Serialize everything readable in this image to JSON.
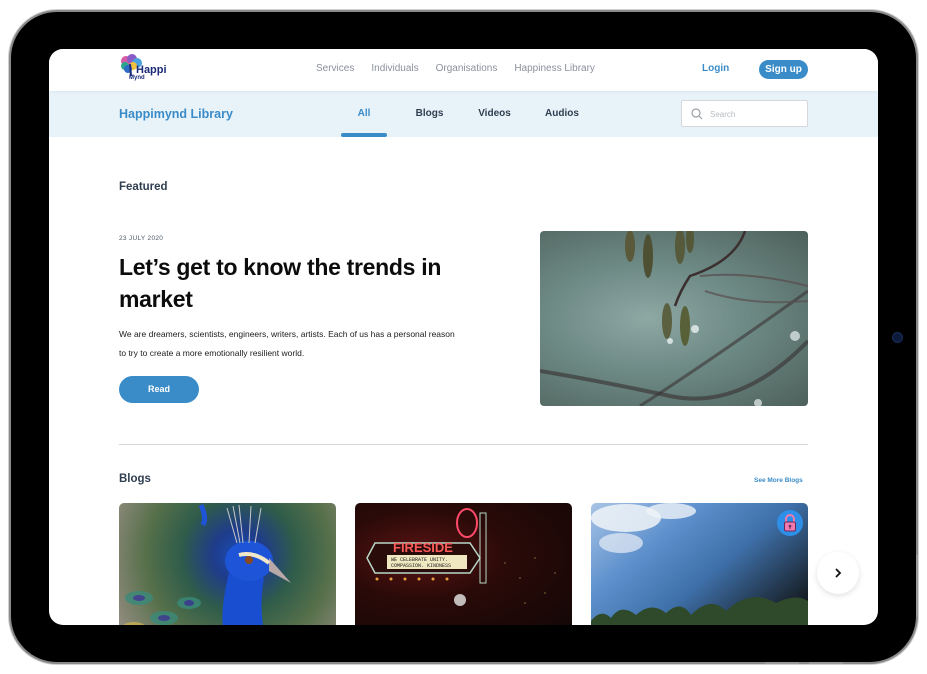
{
  "brand": {
    "logo_text": "Happi",
    "logo_subtext": "Mynd"
  },
  "topnav": {
    "links": [
      "Services",
      "Individuals",
      "Organisations",
      "Happiness Library"
    ],
    "login_label": "Login",
    "signup_label": "Sign up"
  },
  "library": {
    "title": "Happimynd Library",
    "tabs": [
      {
        "label": "All",
        "active": true
      },
      {
        "label": "Blogs",
        "active": false
      },
      {
        "label": "Videos",
        "active": false
      },
      {
        "label": "Audios",
        "active": false
      }
    ],
    "search": {
      "placeholder": "Search",
      "value": ""
    }
  },
  "featured": {
    "section_title": "Featured",
    "date": "23 JULY 2020",
    "headline": "Let’s get to know the trends in market",
    "description": "We are dreamers, scientists, engineers, writers, artists. Each of us has a personal reason to try to create a more emotionally resilient world.",
    "read_label": "Read",
    "image": "branch-with-raindrops-photo"
  },
  "blogs": {
    "section_title": "Blogs",
    "see_more_label": "See More Blogs",
    "cards": [
      {
        "image": "peacock-photo",
        "locked": false
      },
      {
        "image": "fireside-theater-sign-photo",
        "locked": false,
        "sign_text": "FIRESIDE",
        "marquee_text": "WE CELEBRATE UNITY. COMPASSION. KINDNESS"
      },
      {
        "image": "sky-and-trees-photo",
        "locked": true
      }
    ],
    "next_icon": "chevron-right-icon"
  },
  "colors": {
    "accent": "#3a8cc8",
    "library_bar_bg": "#e8f2f9",
    "heading": "#2f3e50",
    "lock_badge": "#2e8fe8"
  }
}
